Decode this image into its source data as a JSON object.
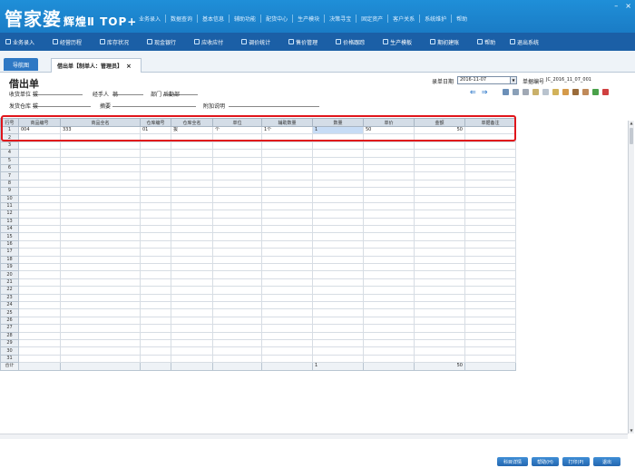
{
  "app": {
    "logo_main": "管家婆",
    "logo_sub": "辉煌Ⅱ TOP+",
    "top_menu": [
      "业务录入",
      "数据查询",
      "基本信息",
      "辅助功能",
      "配货中心",
      "生产模块",
      "决策寻宝",
      "固定资产",
      "客户关系",
      "系统维护",
      "帮助"
    ],
    "window_controls": [
      "–",
      "×"
    ]
  },
  "toolbar": {
    "items": [
      "业务录入",
      "经营历程",
      "库存状况",
      "现金银行",
      "应收应付",
      "调价统计",
      "售价管理",
      "价格跟踪",
      "生产模板",
      "期初建账",
      "帮助"
    ],
    "exit": "退出系统"
  },
  "tabs": {
    "nav_label": "导航图",
    "doc_label": "借出单【制单人：管理员】",
    "close": "×"
  },
  "form": {
    "title": "借出单",
    "recv_unit_label": "收货单位",
    "recv_unit_value": "拔",
    "handler_label": "经手人",
    "handler_value": "翁",
    "dept_label": "部门",
    "dept_value": "后勤部",
    "warehouse_label": "发货仓库",
    "warehouse_value": "拔",
    "summary_label": "摘要",
    "note_label": "附加说明",
    "date_label": "录单日期",
    "date_value": "2016-11-07",
    "docno_label": "单据编号",
    "docno_value": "JC_2016_11_07_001"
  },
  "grid": {
    "columns": [
      "行号",
      "商品编号",
      "商品全名",
      "仓库编号",
      "仓库全名",
      "单位",
      "辅助数量",
      "数量",
      "单价",
      "金额",
      "单据备注"
    ],
    "rows": [
      {
        "no": "1",
        "code": "004",
        "name": "333",
        "wh_code": "01",
        "wh_name": "拔",
        "unit": "个",
        "aux": "1个",
        "qty": "1",
        "price": "50",
        "amount": "50",
        "remark": ""
      }
    ],
    "row_numbers": [
      "2",
      "3",
      "4",
      "5",
      "6",
      "7",
      "8",
      "9",
      "10",
      "11",
      "12",
      "13",
      "14",
      "15",
      "16",
      "17",
      "18",
      "19",
      "20",
      "21",
      "22",
      "23",
      "24",
      "25",
      "26",
      "27",
      "28",
      "29",
      "30",
      "31"
    ],
    "footer": {
      "label": "合计",
      "qty": "1",
      "amount": "50"
    }
  },
  "bottom_buttons": [
    "科目详情",
    "帮助(H)",
    "打印(P)",
    "退出"
  ],
  "colors": {
    "titlebar": "#1f8fd8",
    "toolbar": "#1b5fa6",
    "highlight_box": "#e0151b",
    "selected_cell": "#c7dcf5"
  }
}
